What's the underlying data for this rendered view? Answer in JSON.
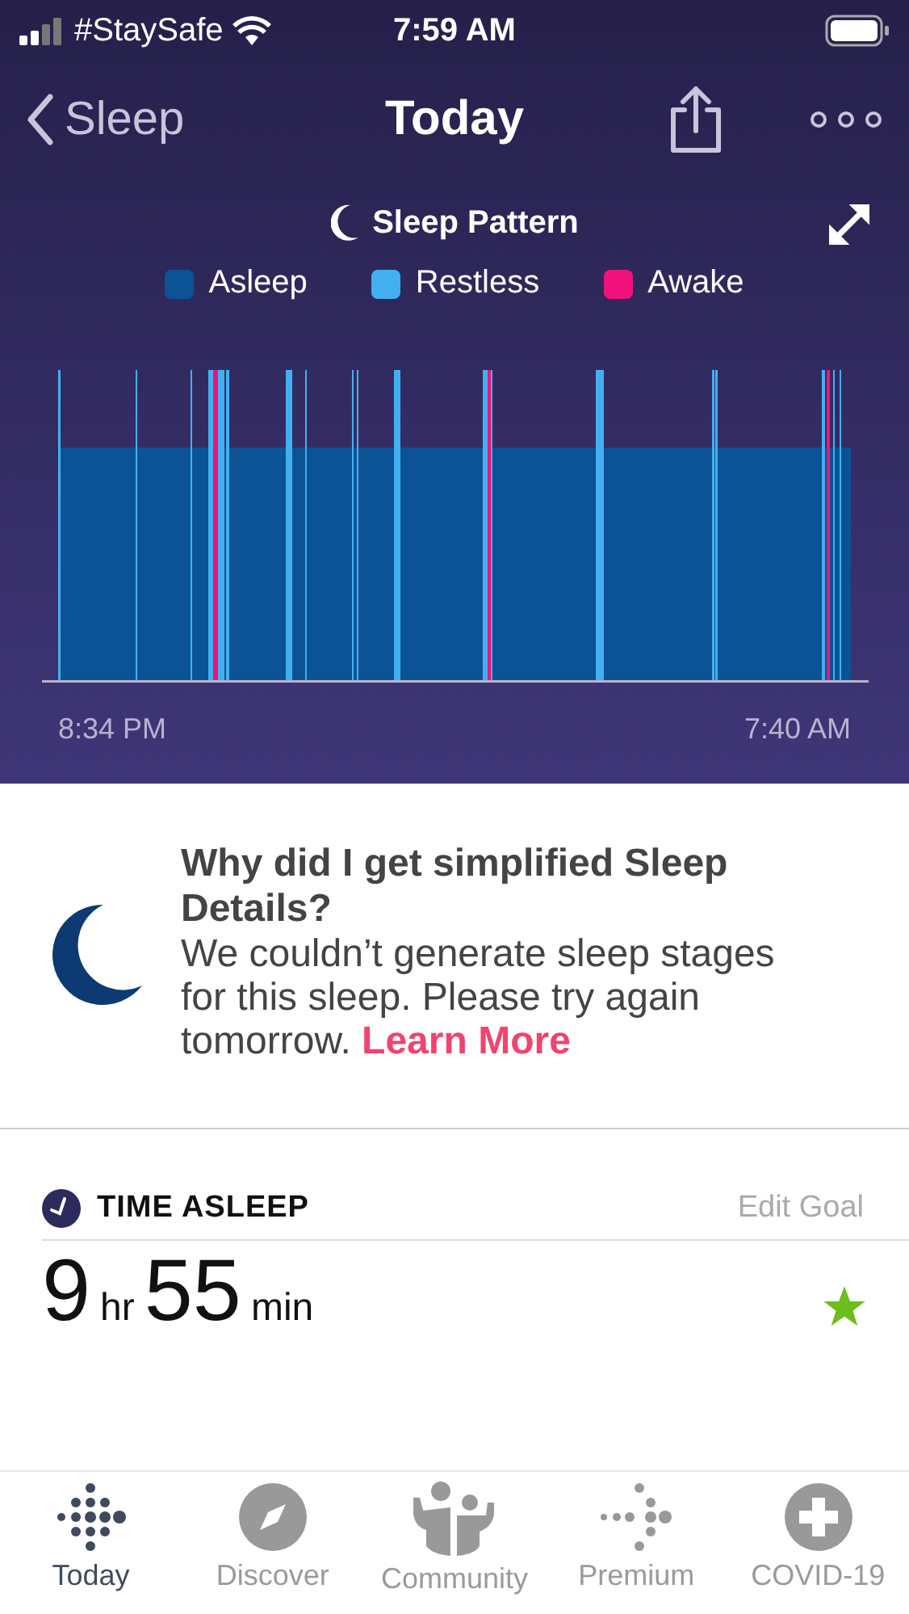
{
  "status_bar": {
    "carrier": "#StaySafe",
    "time": "7:59 AM"
  },
  "nav": {
    "back": "Sleep",
    "title": "Today"
  },
  "chart": {
    "title": "Sleep Pattern",
    "legend": [
      {
        "label": "Asleep",
        "color": "#0b5394"
      },
      {
        "label": "Restless",
        "color": "#42b0f0"
      },
      {
        "label": "Awake",
        "color": "#f0127a"
      }
    ],
    "start": "8:34 PM",
    "end": "7:40 AM"
  },
  "info": {
    "title": "Why did I get simplified Sleep Details?",
    "body": "We couldn’t generate sleep stages for this sleep. Please try again tomorrow.",
    "link": "Learn More"
  },
  "sections": [
    {
      "title": "TIME ASLEEP",
      "action": "Edit Goal",
      "hours": "9",
      "hours_unit": "hr",
      "minutes": "55",
      "minutes_unit": "min",
      "goal_met": true
    }
  ],
  "tabs": [
    {
      "label": "Today",
      "kind": "today",
      "selected": true
    },
    {
      "label": "Discover",
      "kind": "discover",
      "selected": false
    },
    {
      "label": "Community",
      "kind": "community",
      "selected": false
    },
    {
      "label": "Premium",
      "kind": "premium",
      "selected": false
    },
    {
      "label": "COVID-19",
      "kind": "covid",
      "selected": false
    }
  ]
}
